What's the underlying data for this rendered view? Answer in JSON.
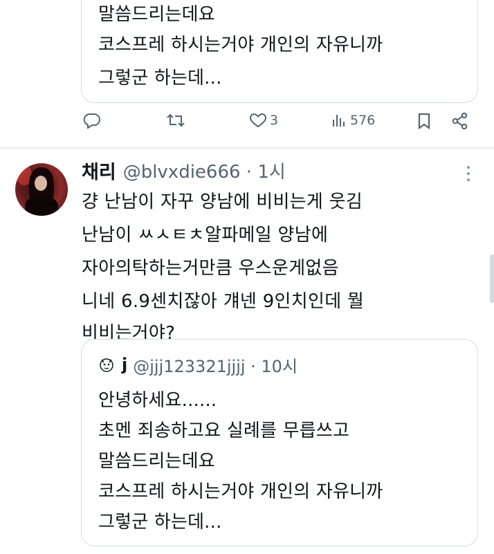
{
  "top_quote": {
    "lines": [
      "말씀드리는데요",
      "코스프레 하시는거야 개인의 자유니까",
      "그렇군 하는데..."
    ]
  },
  "actions": {
    "reply_count": "",
    "retweet_count": "",
    "like_count": "3",
    "views_count": "576"
  },
  "tweet": {
    "author_name": "채리",
    "author_handle_time": "@blvxdie666 · 1시",
    "lines": [
      "걍 난남이 자꾸 양남에 비비는게 웃김",
      "난남이 ㅆㅅㅌㅊ알파메일 양남에",
      "자아의탁하는거만큼 우스운게없음",
      "니네 6.9센치잖아 걔넨 9인치인데 뭘",
      "비비는거야?"
    ]
  },
  "quoted_tweet": {
    "author_name": "j",
    "author_handle_time": "@jjj123321jjjj · 10시",
    "lines": [
      "안녕하세요......",
      "초멘 죄송하고요 실례를 무릅쓰고",
      "말씀드리는데요",
      "코스프레 하시는거야 개인의 자유니까",
      "그렇군 하는데..."
    ]
  },
  "colors": {
    "text": "#0f1419",
    "muted": "#536471",
    "border": "#d6dce0"
  }
}
